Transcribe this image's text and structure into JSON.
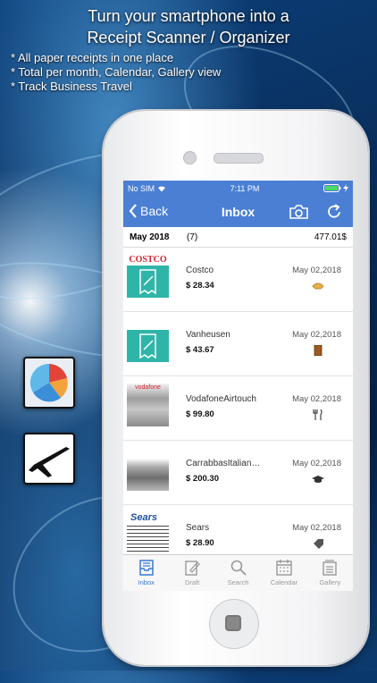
{
  "headline": {
    "line1": "Turn your smartphone into a",
    "line2": "Receipt Scanner / Organizer"
  },
  "bullets": [
    "*  All paper receipts in one place",
    "*  Total per month, Calendar, Gallery view",
    "*  Track Business Travel"
  ],
  "side_icons": [
    "pie-chart-icon",
    "airplane-icon"
  ],
  "status_bar": {
    "carrier": "No SIM",
    "time": "7:11 PM"
  },
  "nav": {
    "back_label": "Back",
    "title": "Inbox"
  },
  "month_summary": {
    "month": "May 2018",
    "count": "(7)",
    "total": "477.01$"
  },
  "receipts": [
    {
      "name": "Costco",
      "amount": "$ 28.34",
      "date": "May 02,2018",
      "category_icon": "handshake-icon"
    },
    {
      "name": "Vanheusen",
      "amount": "$ 43.67",
      "date": "May 02,2018",
      "category_icon": "book-icon"
    },
    {
      "name": "VodafoneAirtouch",
      "amount": "$ 99.80",
      "date": "May 02,2018",
      "category_icon": "fork-knife-icon"
    },
    {
      "name": "CarrabbasItalian…",
      "amount": "$ 200.30",
      "date": "May 02,2018",
      "category_icon": "graduation-cap-icon"
    },
    {
      "name": "Sears",
      "amount": "$ 28.90",
      "date": "May 02,2018",
      "category_icon": "tag-icon"
    }
  ],
  "thumb_logos": {
    "costco": "COSTCO",
    "vodafone": "vodafone",
    "sears": "Sears"
  },
  "tabs": [
    {
      "label": "Inbox",
      "active": true
    },
    {
      "label": "Draft",
      "active": false
    },
    {
      "label": "Search",
      "active": false
    },
    {
      "label": "Calendar",
      "active": false
    },
    {
      "label": "Gallery",
      "active": false
    }
  ],
  "colors": {
    "nav_blue": "#4a7fd4",
    "tab_active": "#3b78d8",
    "receipt_teal": "#2fb5a8"
  }
}
